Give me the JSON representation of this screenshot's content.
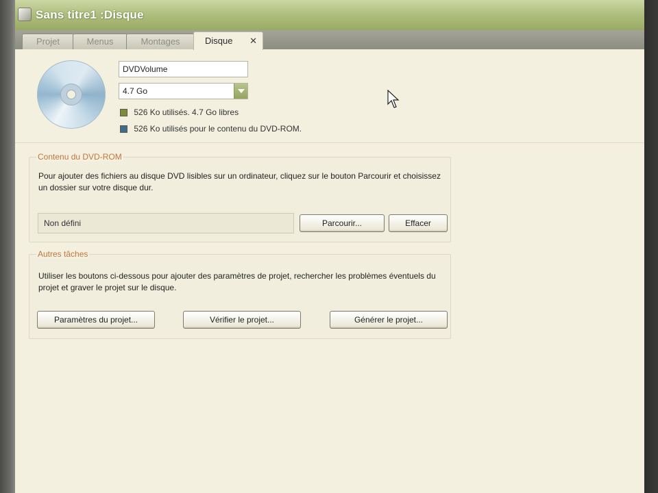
{
  "window": {
    "title": "Sans titre1 :Disque"
  },
  "tabs": [
    {
      "label": "Projet",
      "active": false
    },
    {
      "label": "Menus",
      "active": false
    },
    {
      "label": "Montages",
      "active": false
    },
    {
      "label": "Disque",
      "active": true
    }
  ],
  "tab_close_glyph": "✕",
  "disc": {
    "icon": "cd-disc-icon",
    "volume_name": "DVDVolume",
    "size_selected": "4.7 Go",
    "usage_line1": "526 Ko utilisés. 4.7 Go libres",
    "usage_line2": "526 Ko utilisés pour le contenu du DVD-ROM.",
    "usage_color1": "#7d8b3c",
    "usage_color2": "#3f6b8c"
  },
  "dvdrom_group": {
    "title": "Contenu du DVD-ROM",
    "description": "Pour ajouter des fichiers au disque DVD lisibles sur un ordinateur, cliquez sur le bouton Parcourir et choisissez un dossier sur votre disque dur.",
    "path_value": "Non défini",
    "browse_label": "Parcourir...",
    "clear_label": "Effacer"
  },
  "tasks_group": {
    "title": "Autres tâches",
    "description": "Utiliser les boutons ci-dessous pour ajouter des paramètres de projet, rechercher les problèmes éventuels du projet et graver le projet sur le disque.",
    "settings_label": "Paramètres du projet...",
    "verify_label": "Vérifier le projet...",
    "build_label": "Générer le projet..."
  },
  "colors": {
    "accent_title": "#c2753c",
    "titlebar": "#aebd7c",
    "background": "#f3f0e0"
  }
}
